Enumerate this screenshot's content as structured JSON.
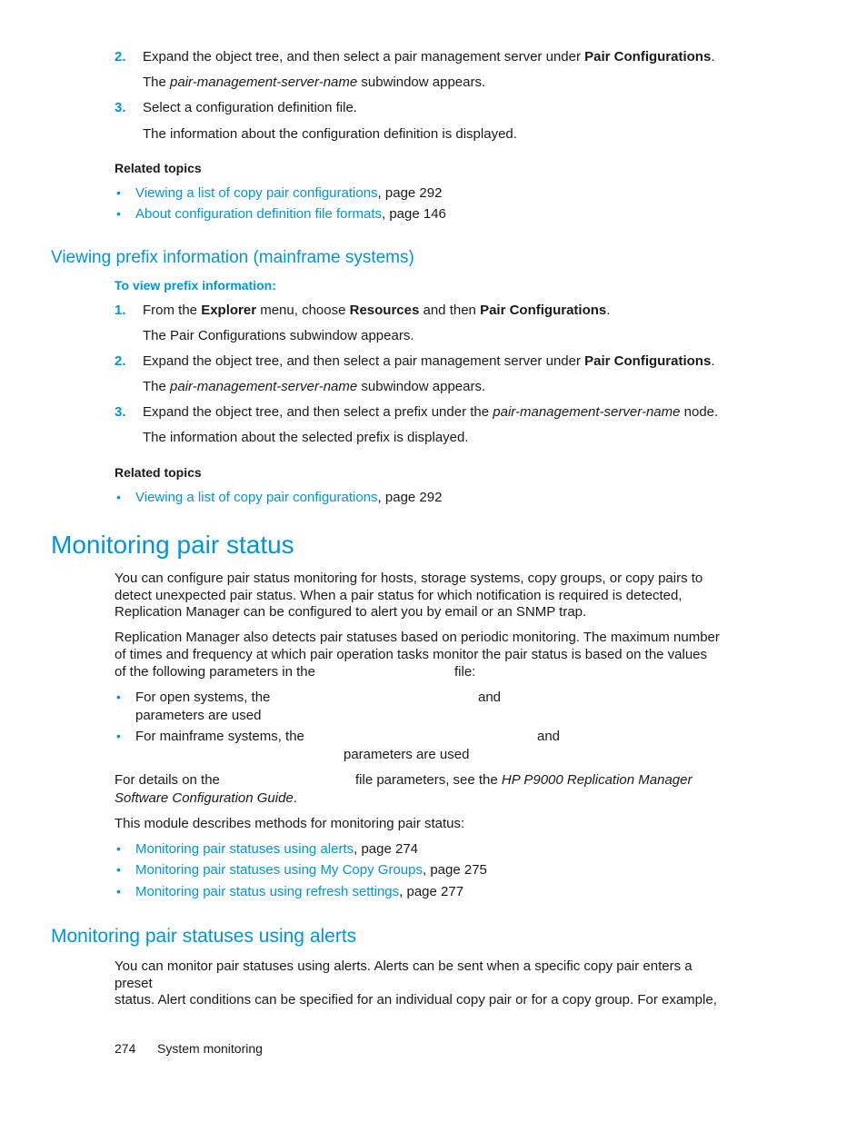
{
  "section1": {
    "steps": [
      {
        "num": "2.",
        "pre": "Expand the object tree, and then select a pair management server under ",
        "bold": "Pair Configurations",
        "post": ".",
        "result_pre": "The ",
        "result_italic": "pair-management-server-name",
        "result_post": " subwindow appears."
      },
      {
        "num": "3.",
        "text": "Select a configuration definition file.",
        "result": "The information about the configuration definition is displayed."
      }
    ],
    "related_title": "Related topics",
    "related": [
      {
        "link": "Viewing a list of copy pair configurations",
        "suffix": ", page 292"
      },
      {
        "link": "About configuration definition file formats",
        "suffix": ", page 146"
      }
    ]
  },
  "section2": {
    "heading": "Viewing prefix information (mainframe systems)",
    "subheading": "To view prefix information:",
    "step1": {
      "num": "1.",
      "a": "From the ",
      "b1": "Explorer",
      "c": " menu, choose ",
      "b2": "Resources",
      "d": " and then ",
      "b3": "Pair Configurations",
      "e": ".",
      "result": "The Pair Configurations subwindow appears."
    },
    "step2": {
      "num": "2.",
      "pre": "Expand the object tree, and then select a pair management server under ",
      "bold": "Pair Configurations",
      "post": ".",
      "result_pre": "The ",
      "result_italic": "pair-management-server-name",
      "result_post": " subwindow appears."
    },
    "step3": {
      "num": "3.",
      "pre": "Expand the object tree, and then select a prefix under the ",
      "italic": "pair-management-server-name",
      "post": " node.",
      "result": "The information about the selected prefix is displayed."
    },
    "related_title": "Related topics",
    "related": [
      {
        "link": "Viewing a list of copy pair configurations",
        "suffix": ", page 292"
      }
    ]
  },
  "section3": {
    "title": "Monitoring pair status",
    "para1": [
      "You can configure pair status monitoring for hosts, storage systems, copy groups, or copy pairs to",
      "detect unexpected pair status. When a pair status for which notification is required is detected,",
      "Replication Manager can be configured to alert you by email or an SNMP trap."
    ],
    "para2": [
      "Replication Manager also detects pair statuses based on periodic monitoring. The maximum number",
      "of times and frequency at which pair operation tasks monitor the pair status is based on the values"
    ],
    "para2_last_a": "of the following parameters in the",
    "para2_last_b": "file:",
    "bullet1_a": "For open systems, the",
    "bullet1_b": "and",
    "bullet1_c": "parameters are used",
    "bullet2_a": "For mainframe systems, the",
    "bullet2_b": "and",
    "bullet2_c": "parameters are used",
    "details_a": "For details on the",
    "details_b": "file parameters, see the ",
    "details_italic1": "HP P9000 Replication Manager",
    "details_italic2": "Software Configuration Guide",
    "details_end": ".",
    "module_intro": "This module describes methods for monitoring pair status:",
    "links": [
      {
        "link": "Monitoring pair statuses using alerts",
        "suffix": ", page 274"
      },
      {
        "link": "Monitoring pair statuses using My Copy Groups",
        "suffix": ", page 275"
      },
      {
        "link": "Monitoring pair status using refresh settings",
        "suffix": ", page 277"
      }
    ]
  },
  "section4": {
    "heading": "Monitoring pair statuses using alerts",
    "para": [
      "You can monitor pair statuses using alerts. Alerts can be sent when a specific copy pair enters a preset",
      "status. Alert conditions can be specified for an individual copy pair or for a copy group. For example,"
    ]
  },
  "footer": {
    "page": "274",
    "chapter": "System monitoring"
  },
  "colors": {
    "accent": "#0096d6",
    "text": "#1a1a1a"
  }
}
